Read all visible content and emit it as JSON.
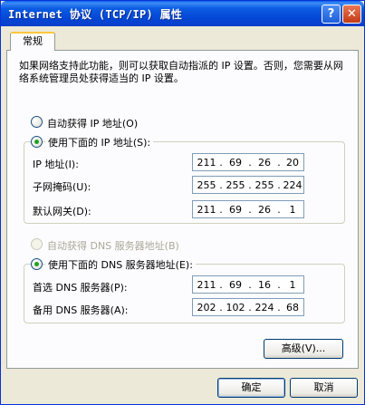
{
  "window": {
    "title": "Internet 协议 (TCP/IP) 属性",
    "help_label": "?",
    "close_label": "✕"
  },
  "tabs": [
    {
      "label": "常规",
      "selected": true
    }
  ],
  "description": "如果网络支持此功能，则可以获取自动指派的 IP 设置。否则，您需要从网络系统管理员处获得适当的 IP 设置。",
  "ip_mode": {
    "auto_label": "自动获得 IP 地址(O)",
    "auto_checked": false,
    "manual_label": "使用下面的 IP 地址(S):",
    "manual_checked": true
  },
  "ip_fields": [
    {
      "label": "IP 地址(I):",
      "octets": [
        "211",
        "69",
        "26",
        "20"
      ]
    },
    {
      "label": "子网掩码(U):",
      "octets": [
        "255",
        "255",
        "255",
        "224"
      ]
    },
    {
      "label": "默认网关(D):",
      "octets": [
        "211",
        "69",
        "26",
        "1"
      ]
    }
  ],
  "dns_mode": {
    "auto_label": "自动获得 DNS 服务器地址(B)",
    "auto_checked": false,
    "auto_disabled": true,
    "manual_label": "使用下面的 DNS 服务器地址(E):",
    "manual_checked": true
  },
  "dns_fields": [
    {
      "label": "首选 DNS 服务器(P):",
      "octets": [
        "211",
        "69",
        "16",
        "1"
      ]
    },
    {
      "label": "备用 DNS 服务器(A):",
      "octets": [
        "202",
        "102",
        "224",
        "68"
      ]
    }
  ],
  "buttons": {
    "advanced": "高级(V)...",
    "ok": "确定",
    "cancel": "取消"
  },
  "colors": {
    "titlebar": "#0b5ce2",
    "window_bg": "#ece9d8",
    "panel_bg": "#fcfcfe",
    "radio_check": "#21a121",
    "tab_accent": "#ffc83c"
  }
}
